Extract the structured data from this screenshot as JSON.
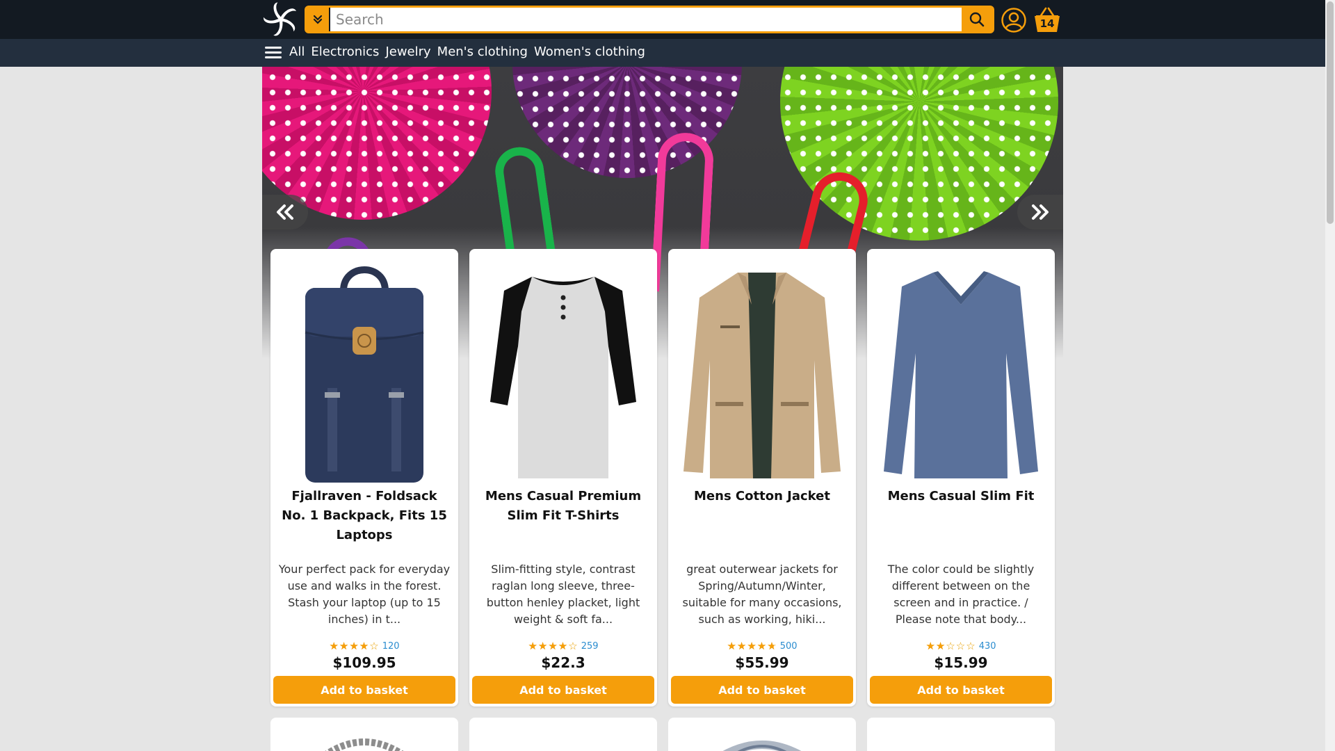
{
  "header": {
    "search_placeholder": "Search",
    "basket_count": "14",
    "icons": {
      "logo": "pinwheel-logo-icon",
      "dropdown": "chevron-double-down-icon",
      "search": "search-icon",
      "account": "user-circle-icon",
      "basket": "basket-icon"
    }
  },
  "nav": {
    "menu_icon": "hamburger-menu-icon",
    "links": [
      "All",
      "Electronics",
      "Jewelry",
      "Men's clothing",
      "Women's clothing"
    ]
  },
  "hero": {
    "prev_icon": "double-chevron-left-icon",
    "next_icon": "double-chevron-right-icon"
  },
  "products": [
    {
      "title": "Fjallraven - Foldsack No. 1 Backpack, Fits 15 Laptops",
      "description": "Your perfect pack for everyday use and walks in the forest. Stash your laptop (up to 15 inches) in t...",
      "rating": 3.9,
      "rating_count": "120",
      "price": "$109.95",
      "button": "Add to basket"
    },
    {
      "title": "Mens Casual Premium Slim Fit T-Shirts",
      "description": "Slim-fitting style, contrast raglan long sleeve, three-button henley placket, light weight & soft fa...",
      "rating": 4.1,
      "rating_count": "259",
      "price": "$22.3",
      "button": "Add to basket"
    },
    {
      "title": "Mens Cotton Jacket",
      "description": "great outerwear jackets for Spring/Autumn/Winter, suitable for many occasions, such as working, hiki...",
      "rating": 4.7,
      "rating_count": "500",
      "price": "$55.99",
      "button": "Add to basket"
    },
    {
      "title": "Mens Casual Slim Fit",
      "description": "The color could be slightly different between on the screen and in practice. / Please note that body...",
      "rating": 2.1,
      "rating_count": "430",
      "price": "$15.99",
      "button": "Add to basket"
    }
  ],
  "colors": {
    "header_bg": "#131a22",
    "nav_bg": "#232f3e",
    "accent": "#f59e0b",
    "page_bg": "#e5e5e5",
    "link": "#2a8ccf"
  }
}
